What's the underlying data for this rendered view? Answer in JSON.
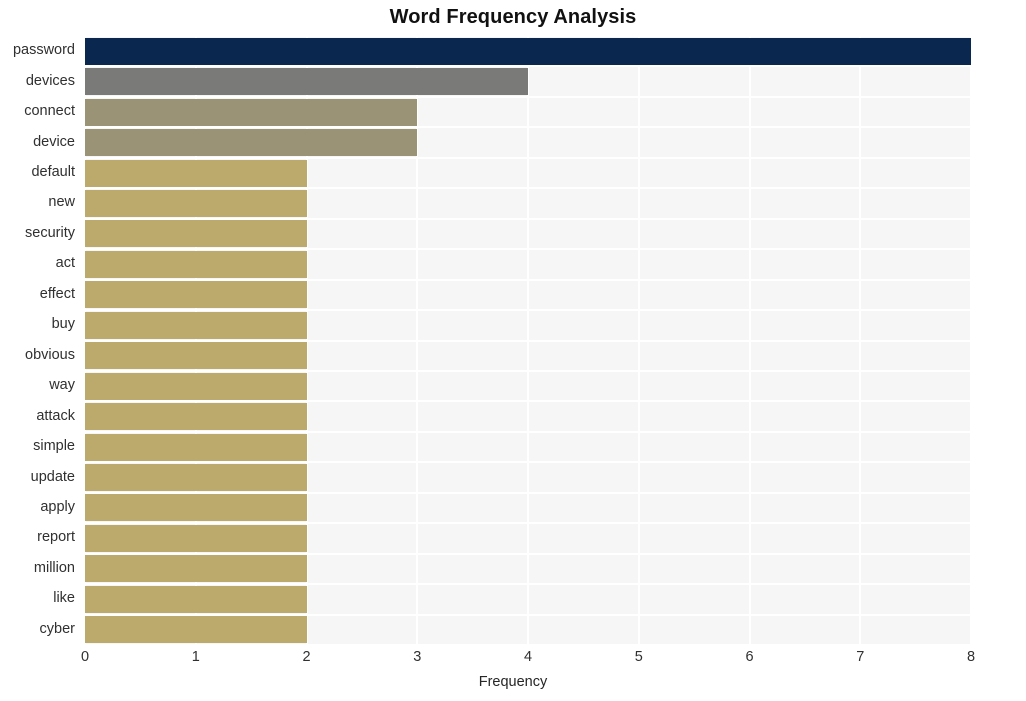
{
  "chart_data": {
    "type": "bar",
    "orientation": "horizontal",
    "title": "Word Frequency Analysis",
    "xlabel": "Frequency",
    "ylabel": "",
    "xlim": [
      0,
      8.0
    ],
    "xticks": [
      "0",
      "1",
      "2",
      "3",
      "4",
      "5",
      "6",
      "7",
      "8"
    ],
    "xtick_values": [
      0,
      1,
      2,
      3,
      4,
      5,
      6,
      7,
      8
    ],
    "grid": "vertical-and-horizontal-white-on-light",
    "legend": "none",
    "categories": [
      "password",
      "devices",
      "connect",
      "device",
      "default",
      "new",
      "security",
      "act",
      "effect",
      "buy",
      "obvious",
      "way",
      "attack",
      "simple",
      "update",
      "apply",
      "report",
      "million",
      "like",
      "cyber"
    ],
    "values": [
      8,
      4,
      3,
      3,
      2,
      2,
      2,
      2,
      2,
      2,
      2,
      2,
      2,
      2,
      2,
      2,
      2,
      2,
      2,
      2
    ],
    "bar_colors": [
      "#0a2750",
      "#7a7a78",
      "#9b9375",
      "#9b9375",
      "#bcaa6d",
      "#bcaa6d",
      "#bcaa6d",
      "#bcaa6d",
      "#bcaa6d",
      "#bcaa6d",
      "#bcaa6d",
      "#bcaa6d",
      "#bcaa6d",
      "#bcaa6d",
      "#bcaa6d",
      "#bcaa6d",
      "#bcaa6d",
      "#bcaa6d",
      "#bcaa6d",
      "#bcaa6d"
    ],
    "plot_background": "#f6f6f6",
    "figure_background": "#ffffff",
    "gridline_color": "#ffffff",
    "text_color": "#303030"
  }
}
